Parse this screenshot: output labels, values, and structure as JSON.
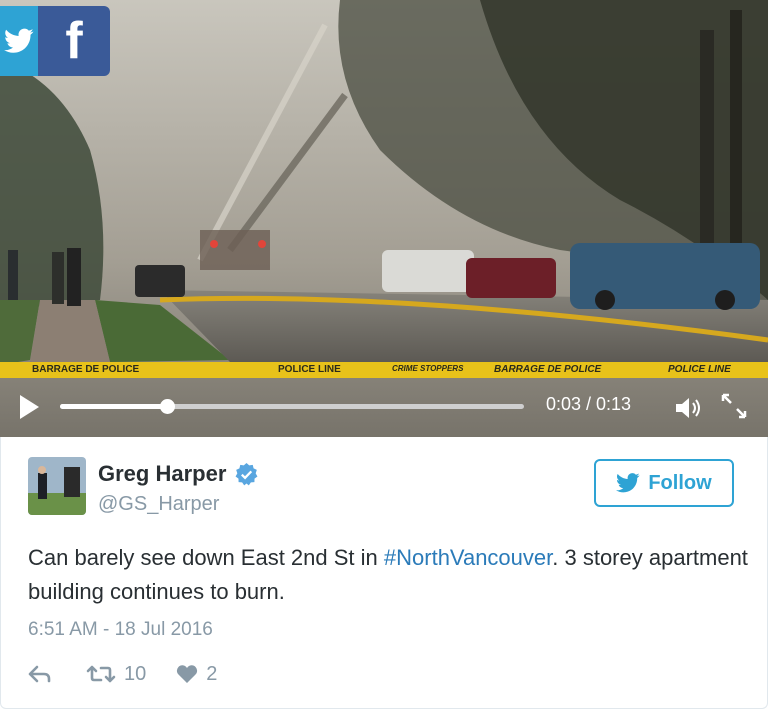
{
  "video": {
    "tape_texts": [
      "BARRAGE DE POLICE",
      "POLICE LINE",
      "CRIME STOPPERS",
      "BARRAGE DE POLICE",
      "POLICE LINE"
    ],
    "time_label": "0:03 / 0:13",
    "progress_fraction": 0.23
  },
  "share": {
    "facebook_glyph": "f"
  },
  "tweet": {
    "author_name": "Greg Harper",
    "author_handle": "@GS_Harper",
    "follow_label": "Follow",
    "text_before": "Can barely see down East 2nd St in ",
    "hashtag": "#NorthVancouver",
    "text_after": ". 3 storey apartment building continues to burn.",
    "timestamp": "6:51 AM - 18 Jul 2016",
    "retweet_count": "10",
    "like_count": "2"
  },
  "colors": {
    "twitter_blue": "#2ea3d4",
    "facebook_blue": "#3a5a98",
    "hashtag_blue": "#2b7bb9",
    "muted_gray": "#8899a6",
    "tape_yellow": "#e8c21a"
  },
  "icons": [
    "twitter-icon",
    "facebook-icon",
    "play-icon",
    "volume-icon",
    "fullscreen-icon",
    "verified-icon",
    "reply-icon",
    "retweet-icon",
    "heart-icon"
  ]
}
